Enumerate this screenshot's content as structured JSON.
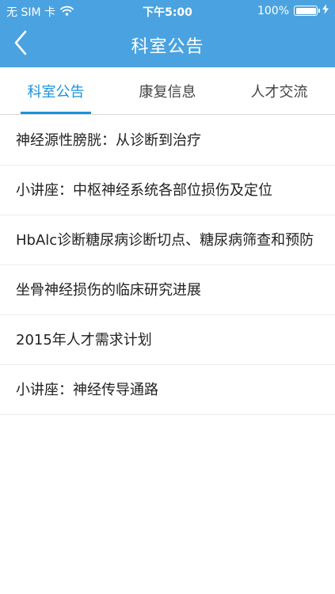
{
  "status_bar": {
    "carrier": "无 SIM 卡",
    "time": "下午5:00",
    "battery": "100%",
    "battery_level": 1.0
  },
  "nav": {
    "title": "科室公告",
    "back_icon": "chevron-left-icon"
  },
  "tabs": [
    {
      "label": "科室公告",
      "active": true
    },
    {
      "label": "康复信息",
      "active": false
    },
    {
      "label": "人才交流",
      "active": false
    }
  ],
  "items": [
    {
      "title": "神经源性膀胱：从诊断到治疗"
    },
    {
      "title": "小讲座：中枢神经系统各部位损伤及定位"
    },
    {
      "title": "HbAlc诊断糖尿病诊断切点、糖尿病筛查和预防"
    },
    {
      "title": "坐骨神经损伤的临床研究进展"
    },
    {
      "title": "2015年人才需求计划"
    },
    {
      "title": "小讲座：神经传导通路"
    }
  ],
  "colors": {
    "header_bg": "#4aa3e0",
    "accent": "#1a93dd"
  }
}
